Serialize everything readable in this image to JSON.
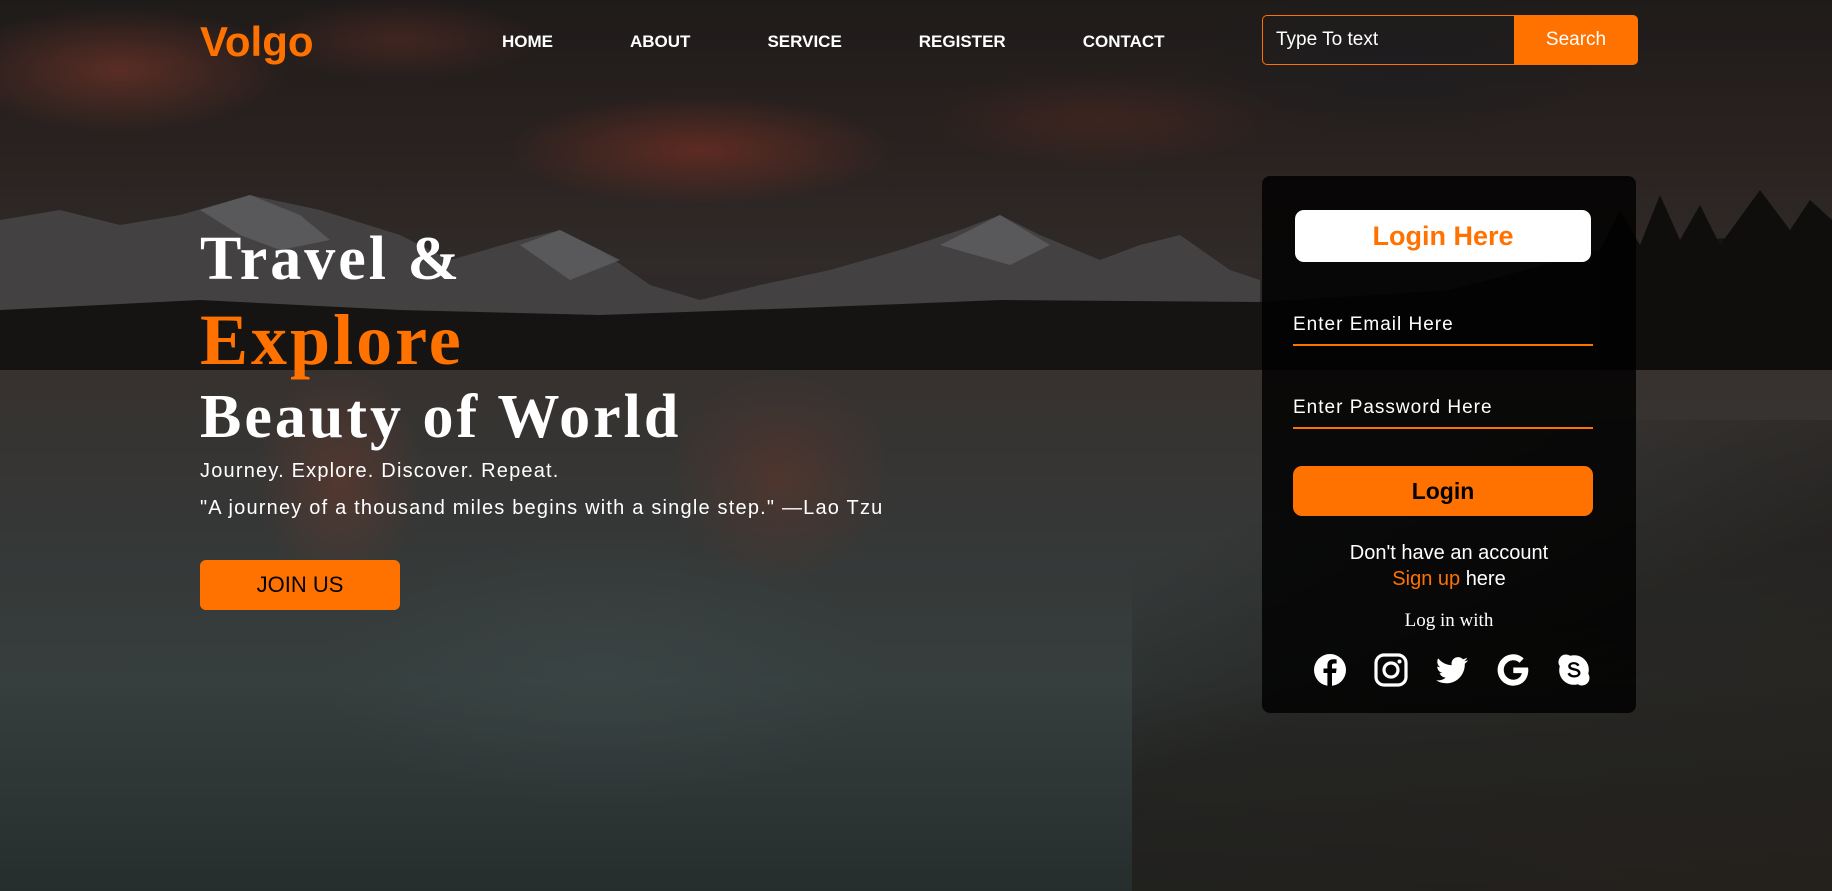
{
  "brand": {
    "logo": "Volgo",
    "accent_color": "#ff7200"
  },
  "nav": {
    "items": [
      "HOME",
      "ABOUT",
      "SERVICE",
      "REGISTER",
      "CONTACT"
    ]
  },
  "search": {
    "placeholder": "Type To text",
    "button_label": "Search"
  },
  "hero": {
    "line1": "Travel &",
    "line2": "Explore",
    "line3": "Beauty of World",
    "tagline": "Journey. Explore. Discover. Repeat.",
    "quote": "\"A journey of a thousand miles begins with a single step.\" —Lao Tzu",
    "cta_label": "JOIN US"
  },
  "login": {
    "title": "Login Here",
    "email_placeholder": "Enter Email Here",
    "password_placeholder": "Enter Password Here",
    "button_label": "Login",
    "no_account_text": "Don't have an account",
    "signup_link": "Sign up",
    "signup_suffix": "here",
    "social_label": "Log in with",
    "social_icons": [
      "facebook-icon",
      "instagram-icon",
      "twitter-icon",
      "google-icon",
      "skype-icon"
    ]
  }
}
